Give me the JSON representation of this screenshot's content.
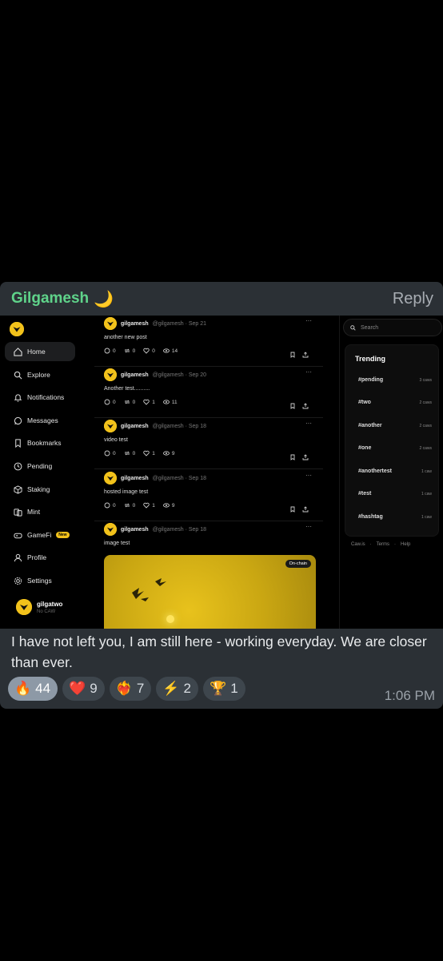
{
  "message": {
    "sender": "Gilgamesh",
    "sender_emoji": "🌙",
    "reply_label": "Reply",
    "text": "I have not left you, I am still here - working everyday. We are closer than ever.",
    "time": "1:06 PM",
    "reactions": [
      {
        "emoji": "🔥",
        "count": "44",
        "mine": true
      },
      {
        "emoji": "❤️",
        "count": "9",
        "mine": false
      },
      {
        "emoji": "❤️‍🔥",
        "count": "7",
        "mine": false
      },
      {
        "emoji": "⚡",
        "count": "2",
        "mine": false
      },
      {
        "emoji": "🏆",
        "count": "1",
        "mine": false
      }
    ]
  },
  "screenshot": {
    "nav": [
      {
        "label": "Home",
        "icon": "home-icon",
        "active": true
      },
      {
        "label": "Explore",
        "icon": "search-icon"
      },
      {
        "label": "Notifications",
        "icon": "bell-icon"
      },
      {
        "label": "Messages",
        "icon": "chat-icon"
      },
      {
        "label": "Bookmarks",
        "icon": "bookmark-icon"
      },
      {
        "label": "Pending",
        "icon": "clock-icon"
      },
      {
        "label": "Staking",
        "icon": "cube-icon"
      },
      {
        "label": "Mint",
        "icon": "mint-icon"
      },
      {
        "label": "GameFi",
        "icon": "gamepad-icon",
        "badge": "New"
      },
      {
        "label": "Profile",
        "icon": "user-icon"
      },
      {
        "label": "Settings",
        "icon": "gear-icon"
      }
    ],
    "user": {
      "name": "gilgatwo",
      "sub": "No CAW"
    },
    "posts": [
      {
        "name": "gilgamesh",
        "handle": "@gilgamesh · Sep 21",
        "text": "another new post",
        "replies": "0",
        "recaws": "0",
        "likes": "0",
        "views": "14"
      },
      {
        "name": "gilgamesh",
        "handle": "@gilgamesh · Sep 20",
        "text": "Another test..........",
        "replies": "0",
        "recaws": "0",
        "likes": "1",
        "views": "11"
      },
      {
        "name": "gilgamesh",
        "handle": "@gilgamesh · Sep 18",
        "text": "video test",
        "replies": "0",
        "recaws": "0",
        "likes": "1",
        "views": "9"
      },
      {
        "name": "gilgamesh",
        "handle": "@gilgamesh · Sep 18",
        "text": "hosted image test",
        "replies": "0",
        "recaws": "0",
        "likes": "1",
        "views": "9"
      },
      {
        "name": "gilgamesh",
        "handle": "@gilgamesh · Sep 18",
        "text": "image test",
        "badge": "On-chain"
      }
    ],
    "more_label": "···",
    "search_placeholder": "Search",
    "trending_title": "Trending",
    "trending": [
      {
        "tag": "#pending",
        "count": "3 caws"
      },
      {
        "tag": "#two",
        "count": "2 caws"
      },
      {
        "tag": "#another",
        "count": "2 caws"
      },
      {
        "tag": "#one",
        "count": "2 caws"
      },
      {
        "tag": "#anothertest",
        "count": "1 caw"
      },
      {
        "tag": "#test",
        "count": "1 caw"
      },
      {
        "tag": "#hashtag",
        "count": "1 caw"
      }
    ],
    "footer": [
      "Caw.is",
      "·",
      "Terms",
      "·",
      "Help"
    ]
  }
}
